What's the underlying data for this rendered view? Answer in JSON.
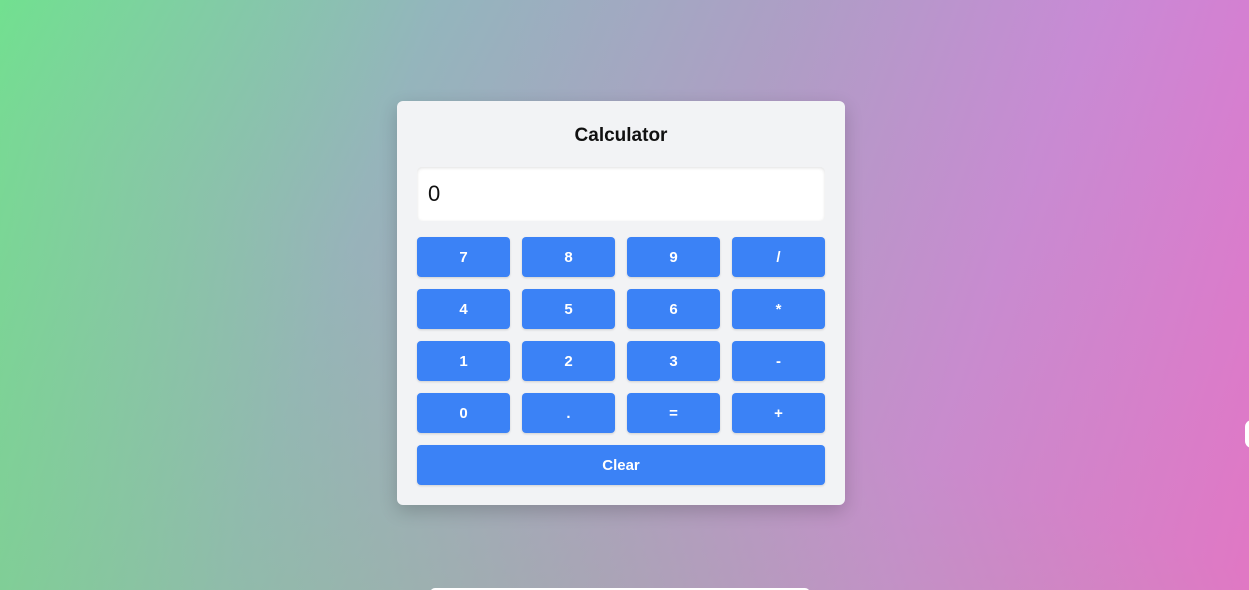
{
  "calculator": {
    "title": "Calculator",
    "display_value": "0",
    "keys": [
      {
        "label": "7",
        "name": "key-7"
      },
      {
        "label": "8",
        "name": "key-8"
      },
      {
        "label": "9",
        "name": "key-9"
      },
      {
        "label": "/",
        "name": "key-divide"
      },
      {
        "label": "4",
        "name": "key-4"
      },
      {
        "label": "5",
        "name": "key-5"
      },
      {
        "label": "6",
        "name": "key-6"
      },
      {
        "label": "*",
        "name": "key-multiply"
      },
      {
        "label": "1",
        "name": "key-1"
      },
      {
        "label": "2",
        "name": "key-2"
      },
      {
        "label": "3",
        "name": "key-3"
      },
      {
        "label": "-",
        "name": "key-subtract"
      },
      {
        "label": "0",
        "name": "key-0"
      },
      {
        "label": ".",
        "name": "key-decimal"
      },
      {
        "label": "=",
        "name": "key-equals"
      },
      {
        "label": "+",
        "name": "key-add"
      }
    ],
    "clear_label": "Clear"
  },
  "colors": {
    "button": "#3b82f6",
    "card": "#f2f3f5",
    "gradient_start": "#66ea8f",
    "gradient_end": "#e572cc"
  }
}
